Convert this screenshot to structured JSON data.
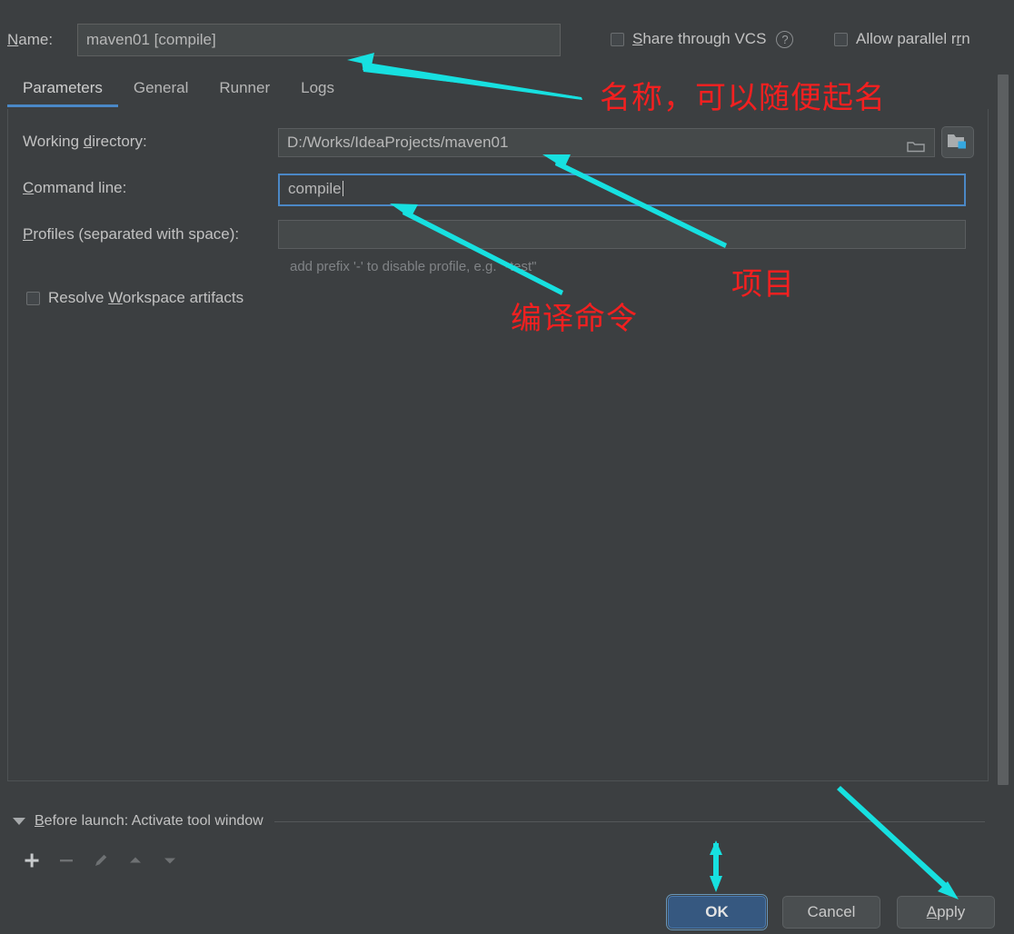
{
  "dialog": {
    "name_label": "Name:",
    "name_label_mnemonic": "N",
    "name_value": "maven01 [compile]",
    "share_vcs_label": "Share through VCS",
    "share_vcs_mnemonic": "S",
    "share_vcs_checked": false,
    "help_icon": "question-circle-icon",
    "allow_parallel_label": "Allow parallel run",
    "allow_parallel_mnemonic": "r",
    "allow_parallel_checked": false
  },
  "tabs": [
    {
      "label": "Parameters",
      "active": true
    },
    {
      "label": "General",
      "active": false
    },
    {
      "label": "Runner",
      "active": false
    },
    {
      "label": "Logs",
      "active": false
    }
  ],
  "parameters": {
    "working_directory": {
      "label": "Working directory:",
      "mnemonic": "d",
      "value": "D:/Works/IdeaProjects/maven01",
      "browse_icon": "folder-icon",
      "module_icon": "module-folder-icon"
    },
    "command_line": {
      "label": "Command line:",
      "mnemonic": "C",
      "value": "compile",
      "focused": true
    },
    "profiles": {
      "label": "Profiles (separated with space):",
      "mnemonic": "P",
      "value": "",
      "hint": "add prefix '-' to disable profile, e.g. \"-test\""
    },
    "resolve_workspace": {
      "label": "Resolve Workspace artifacts",
      "mnemonic": "W",
      "checked": false
    }
  },
  "before_launch": {
    "expand_icon": "triangle-down-icon",
    "label": "Before launch: Activate tool window",
    "mnemonic": "B",
    "toolbar": [
      {
        "name": "add-icon",
        "glyph": "+",
        "enabled": true
      },
      {
        "name": "remove-icon",
        "glyph": "−",
        "enabled": false
      },
      {
        "name": "edit-pencil-icon",
        "glyph": "pencil",
        "enabled": false
      },
      {
        "name": "move-up-icon",
        "glyph": "▲",
        "enabled": false
      },
      {
        "name": "move-down-icon",
        "glyph": "▼",
        "enabled": false
      }
    ]
  },
  "buttons": {
    "ok": "OK",
    "cancel": "Cancel",
    "apply": "Apply",
    "apply_mnemonic": "A"
  },
  "annotations": [
    {
      "id": "name-note",
      "text": "名称，可以随便起名"
    },
    {
      "id": "project-note",
      "text": "项目"
    },
    {
      "id": "command-note",
      "text": "编译命令"
    }
  ],
  "colors": {
    "background": "#3c3f41",
    "field_background": "#45494a",
    "accent_blue": "#4a88c7",
    "default_button": "#365880",
    "annotation_red": "#f32020",
    "arrow_cyan": "#17e0e0",
    "module_icon_blue": "#35a7e0"
  },
  "scrollbar": {
    "name": "vertical-scrollbar",
    "visible": true
  }
}
